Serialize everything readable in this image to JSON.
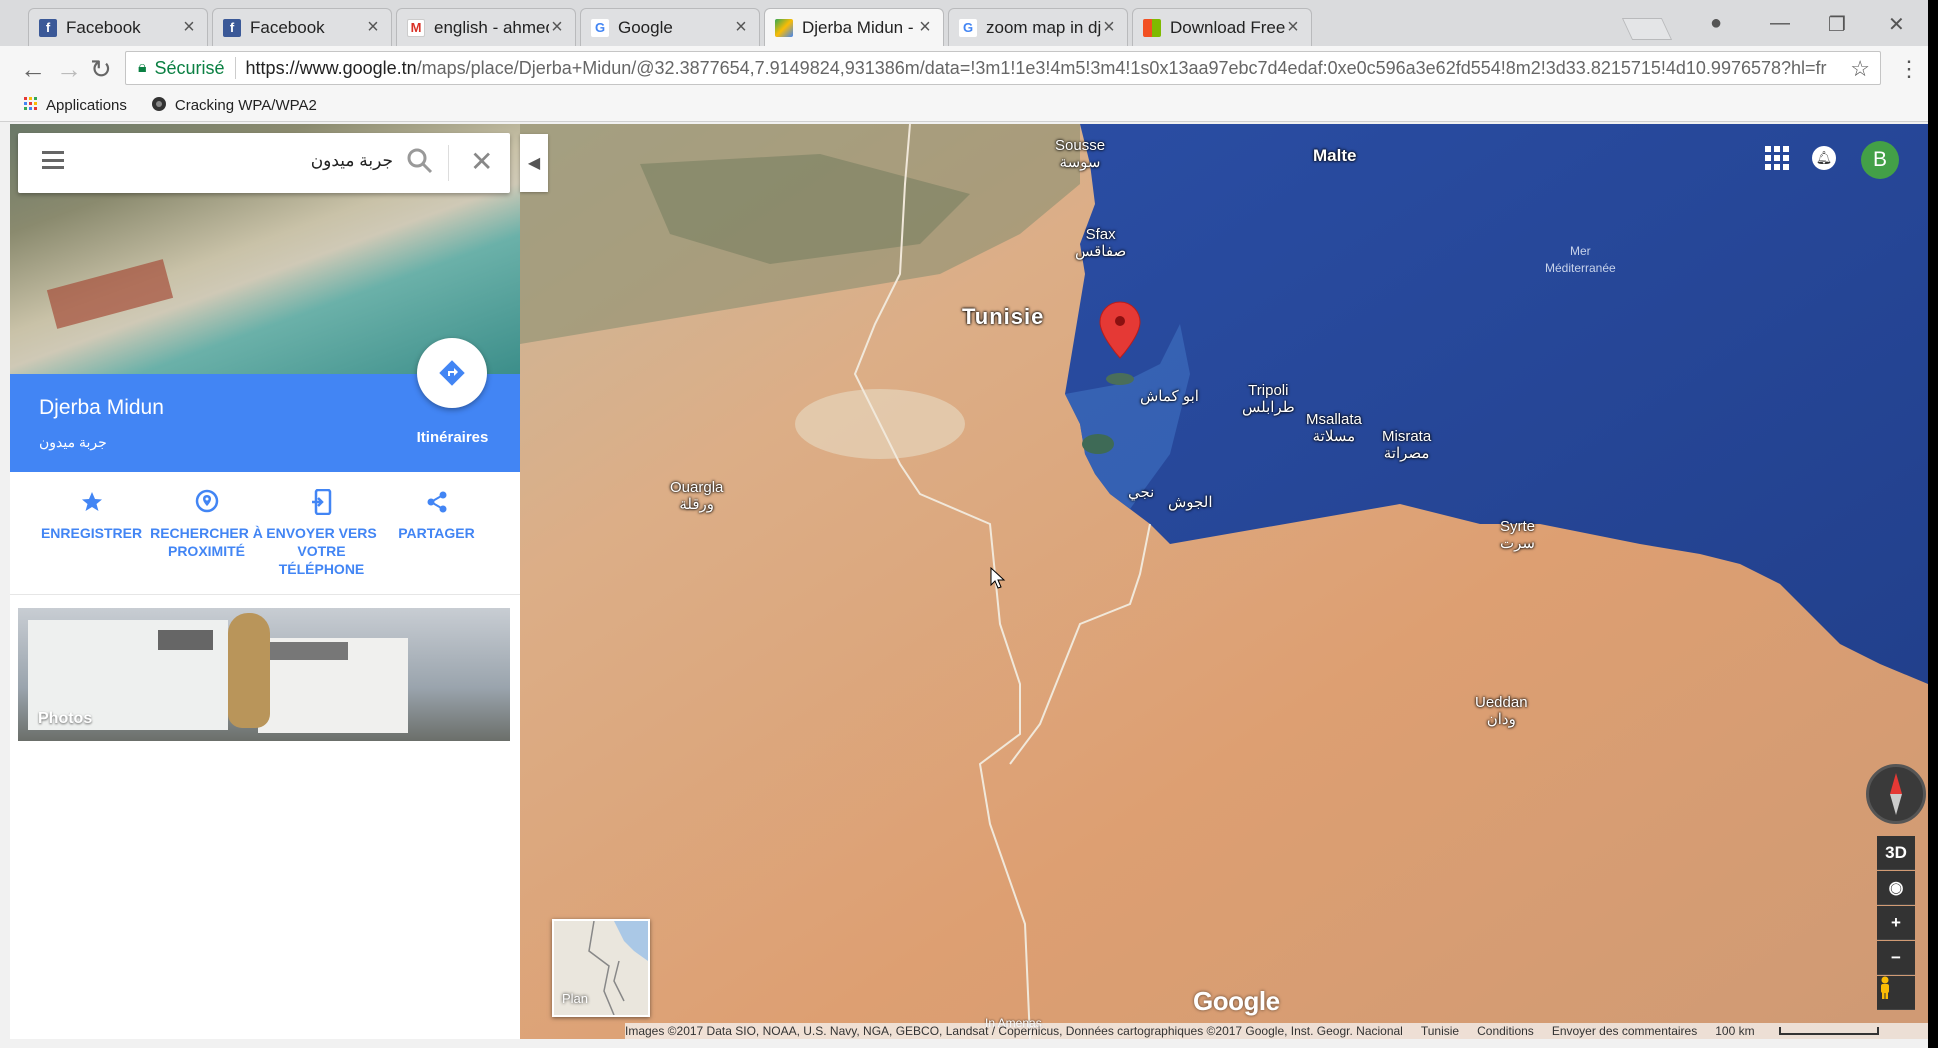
{
  "browser": {
    "tabs": [
      {
        "label": "Facebook",
        "icon": "facebook-icon",
        "active": false
      },
      {
        "label": "Facebook",
        "icon": "facebook-icon",
        "active": false
      },
      {
        "label": "english - ahmed.benab",
        "icon": "gmail-icon",
        "active": false
      },
      {
        "label": "Google",
        "icon": "google-icon",
        "active": false
      },
      {
        "label": "Djerba Midun - Google",
        "icon": "maps-icon",
        "active": true
      },
      {
        "label": "zoom map in djerba - ",
        "icon": "google-icon",
        "active": false
      },
      {
        "label": "Download FreeScreenV",
        "icon": "windows-icon",
        "active": false
      }
    ],
    "secure_label": "Sécurisé",
    "url_host": "https://www.google.tn",
    "url_path": "/maps/place/Djerba+Midun/@32.3877654,7.9149824,931386m/data=!3m1!1e3!4m5!3m4!1s0x13aa97ebc7d4edaf:0xe0c596a3e62fd554!8m2!3d33.8215715!4d10.9976578?hl=fr",
    "bookmarks": [
      {
        "label": "Applications",
        "icon": "apps-grid-icon"
      },
      {
        "label": "Cracking WPA/WPA2",
        "icon": "globe-icon"
      }
    ]
  },
  "panel": {
    "search_query": "جربة ميدون",
    "place_name": "Djerba Midun",
    "place_name_ar": "جربة ميدون",
    "directions_label": "Itinéraires",
    "actions": [
      {
        "label": "ENREGISTRER",
        "icon": "star-icon"
      },
      {
        "label": "RECHERCHER À PROXIMITÉ",
        "icon": "nearby-pin-icon"
      },
      {
        "label": "ENVOYER VERS VOTRE TÉLÉPHONE",
        "icon": "send-to-phone-icon"
      },
      {
        "label": "PARTAGER",
        "icon": "share-icon"
      }
    ],
    "photos_label": "Photos"
  },
  "map": {
    "labels": {
      "sousse": "Sousse",
      "sousse_ar": "سوسة",
      "malte": "Malte",
      "sfax": "Sfax",
      "sfax_ar": "صفاقس",
      "mer": "Mer",
      "mediterranee": "Méditerranée",
      "tunisie": "Tunisie",
      "tripoli": "Tripoli",
      "tripoli_ar": "طرابلس",
      "abou_kammach": "ابو كماش",
      "msallata": "Msallata",
      "msallata_ar": "مسلاتة",
      "misrata": "Misrata",
      "misrata_ar": "مصراتة",
      "ouargla": "Ouargla",
      "ouargla_ar": "ورقلة",
      "nedjet": "نجي",
      "al_jawsh": "الجوش",
      "syrte": "Syrte",
      "syrte_ar": "سرت",
      "ueddan": "Ueddan",
      "ueddan_ar": "ودان",
      "in_amenas": "In Amenas"
    },
    "avatar_letter": "B",
    "btn_3d": "3D",
    "zoom_in": "+",
    "zoom_out": "−",
    "minimap_label": "Plan",
    "logo": "Google",
    "footer": {
      "imagery": "Images ©2017 Data SIO, NOAA, U.S. Navy, NGA, GEBCO, Landsat / Copernicus, Données cartographiques ©2017 Google, Inst. Geogr. Nacional",
      "country": "Tunisie",
      "conditions": "Conditions",
      "feedback": "Envoyer des commentaires",
      "scale": "100 km"
    },
    "colors": {
      "sea": "#2f52a6",
      "desert": "#d9a27a",
      "brand_blue": "#4285f4",
      "pin": "#e53935"
    }
  }
}
